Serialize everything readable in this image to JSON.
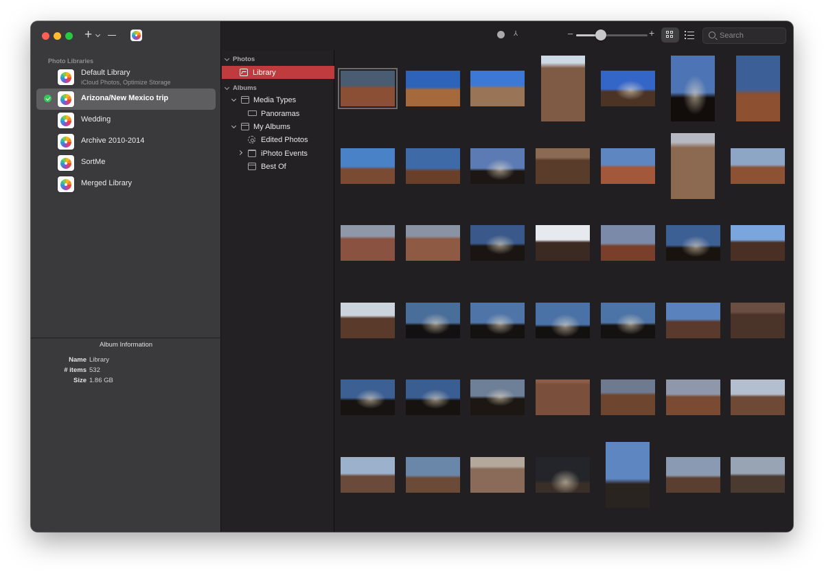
{
  "toolbar": {
    "add_label": "+",
    "remove_label": "—"
  },
  "sidebar": {
    "section_title": "Photo Libraries",
    "libraries": [
      {
        "name": "Default Library",
        "subtitle": "iCloud Photos, Optimize Storage",
        "active": false
      },
      {
        "name": "Arizona/New Mexico trip",
        "subtitle": "",
        "active": true
      },
      {
        "name": "Wedding",
        "subtitle": "",
        "active": false
      },
      {
        "name": "Archive 2010-2014",
        "subtitle": "",
        "active": false
      },
      {
        "name": "SortMe",
        "subtitle": "",
        "active": false
      },
      {
        "name": "Merged Library",
        "subtitle": "",
        "active": false
      }
    ]
  },
  "album_info": {
    "title": "Album Information",
    "rows": [
      {
        "key": "Name",
        "value": "Library"
      },
      {
        "key": "# items",
        "value": "532"
      },
      {
        "key": "Size",
        "value": "1.86 GB"
      }
    ]
  },
  "tree": {
    "photos_section": "Photos",
    "library": "Library",
    "albums_section": "Albums",
    "media_types": "Media Types",
    "panoramas": "Panoramas",
    "my_albums": "My Albums",
    "edited_photos": "Edited Photos",
    "iphoto_events": "iPhoto Events",
    "best_of": "Best Of"
  },
  "zoom": {
    "value": 0.35,
    "minus": "–",
    "plus": "+"
  },
  "search": {
    "placeholder": "Search",
    "value": ""
  },
  "colors": {
    "accent_selected": "#bf3b3d",
    "window_bg": "#211f22",
    "sidebar_bg": "#3a393b"
  },
  "thumbnails": [
    {
      "orient": "l",
      "sky": "#4a5c72",
      "ground": "#8a4f34",
      "horizon": 0.45,
      "selected": true
    },
    {
      "orient": "l",
      "sky": "#2d63b8",
      "ground": "#a5693c",
      "horizon": 0.5
    },
    {
      "orient": "l",
      "sky": "#3d78d6",
      "ground": "#9a7456",
      "horizon": 0.45
    },
    {
      "orient": "p",
      "sky": "#cdd9e5",
      "ground": "#7f5a45",
      "horizon": 0.15
    },
    {
      "orient": "l",
      "sky": "#3466c8",
      "ground": "#4b3426",
      "horizon": 0.55,
      "dark": true
    },
    {
      "orient": "p",
      "sky": "#4d74b4",
      "ground": "#120d0b",
      "horizon": 0.6,
      "dark": true
    },
    {
      "orient": "p",
      "sky": "#3c5f98",
      "ground": "#8d5030",
      "horizon": 0.55
    },
    {
      "orient": "l",
      "sky": "#4a82c8",
      "ground": "#7a4a33",
      "horizon": 0.55
    },
    {
      "orient": "l",
      "sky": "#3f6aa8",
      "ground": "#6a3f2a",
      "horizon": 0.6
    },
    {
      "orient": "l",
      "sky": "#5c7ab4",
      "ground": "#1c1714",
      "horizon": 0.6,
      "dark": true
    },
    {
      "orient": "l",
      "sky": "#8a6a52",
      "ground": "#5a3c2b",
      "horizon": 0.3
    },
    {
      "orient": "l",
      "sky": "#5e87c2",
      "ground": "#a4583a",
      "horizon": 0.5
    },
    {
      "orient": "p",
      "sky": "#b6b9c2",
      "ground": "#8c6a52",
      "horizon": 0.18
    },
    {
      "orient": "l",
      "sky": "#8ea6c6",
      "ground": "#8c5233",
      "horizon": 0.5
    },
    {
      "orient": "l",
      "sky": "#8f98a8",
      "ground": "#8a5241",
      "horizon": 0.35
    },
    {
      "orient": "l",
      "sky": "#8a93a4",
      "ground": "#8e5a44",
      "horizon": 0.35
    },
    {
      "orient": "l",
      "sky": "#3a598a",
      "ground": "#1a1512",
      "horizon": 0.55,
      "dark": true
    },
    {
      "orient": "l",
      "sky": "#e6e9ee",
      "ground": "#3a2a22",
      "horizon": 0.45
    },
    {
      "orient": "l",
      "sky": "#7b8aa8",
      "ground": "#7a3f2a",
      "horizon": 0.55
    },
    {
      "orient": "l",
      "sky": "#3c5f94",
      "ground": "#18130f",
      "horizon": 0.6,
      "dark": true
    },
    {
      "orient": "l",
      "sky": "#7aa6dd",
      "ground": "#4a3024",
      "horizon": 0.45
    },
    {
      "orient": "l",
      "sky": "#cbd3dc",
      "ground": "#5a3a2a",
      "horizon": 0.4
    },
    {
      "orient": "l",
      "sky": "#4a6e9a",
      "ground": "#121010",
      "horizon": 0.6,
      "dark": true
    },
    {
      "orient": "l",
      "sky": "#4f75a8",
      "ground": "#141111",
      "horizon": 0.6,
      "dark": true
    },
    {
      "orient": "l",
      "sky": "#4b72a6",
      "ground": "#131010",
      "horizon": 0.65,
      "dark": true
    },
    {
      "orient": "l",
      "sky": "#4d74a6",
      "ground": "#141111",
      "horizon": 0.6,
      "dark": true
    },
    {
      "orient": "l",
      "sky": "#5a82bc",
      "ground": "#5a3a2c",
      "horizon": 0.5
    },
    {
      "orient": "l",
      "sky": "#6a4e42",
      "ground": "#4a3329",
      "horizon": 0.3
    },
    {
      "orient": "l",
      "sky": "#3c5f94",
      "ground": "#171311",
      "horizon": 0.55,
      "dark": true
    },
    {
      "orient": "l",
      "sky": "#3b5e92",
      "ground": "#161210",
      "horizon": 0.55,
      "dark": true
    },
    {
      "orient": "l",
      "sky": "#6e7f98",
      "ground": "#1c1713",
      "horizon": 0.5,
      "dark": true
    },
    {
      "orient": "l",
      "sky": "#8c5e48",
      "ground": "#7a4f3b",
      "horizon": 0.1
    },
    {
      "orient": "l",
      "sky": "#6d7a90",
      "ground": "#6e4630",
      "horizon": 0.4
    },
    {
      "orient": "l",
      "sky": "#8f98ab",
      "ground": "#7a4a32",
      "horizon": 0.45
    },
    {
      "orient": "l",
      "sky": "#b3bfcf",
      "ground": "#6e4a36",
      "horizon": 0.45
    },
    {
      "orient": "l",
      "sky": "#9cb2cc",
      "ground": "#6a4a3a",
      "horizon": 0.5
    },
    {
      "orient": "l",
      "sky": "#6a86a8",
      "ground": "#6b4a38",
      "horizon": 0.55
    },
    {
      "orient": "l",
      "sky": "#b4a89c",
      "ground": "#8a6a58",
      "horizon": 0.3
    },
    {
      "orient": "l",
      "sky": "#24252a",
      "ground": "#3a2e28",
      "horizon": 0.7,
      "dark": true
    },
    {
      "orient": "p",
      "sky": "#5e86c0",
      "ground": "#2a2420",
      "horizon": 0.6
    },
    {
      "orient": "l",
      "sky": "#8a9ab2",
      "ground": "#5a3f30",
      "horizon": 0.55
    },
    {
      "orient": "l",
      "sky": "#98a4b4",
      "ground": "#4a3a30",
      "horizon": 0.5
    }
  ]
}
